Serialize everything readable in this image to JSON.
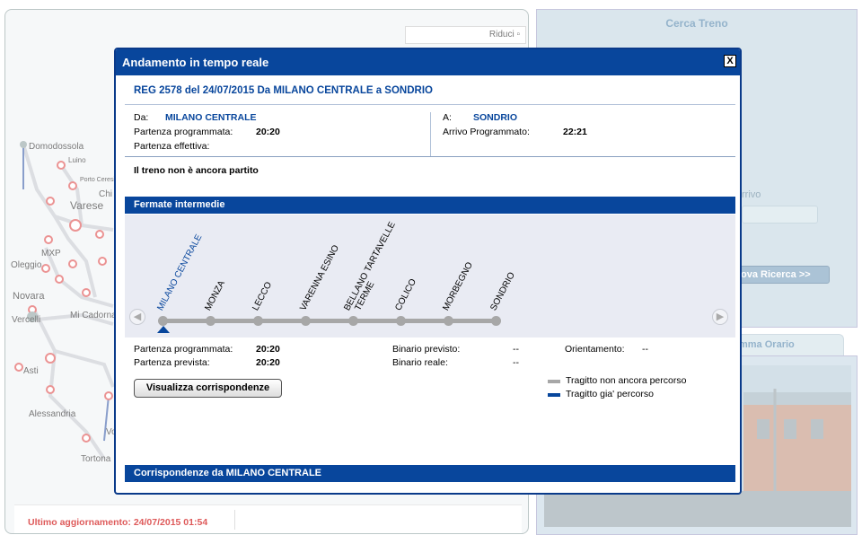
{
  "map": {
    "riduci_label": "Riduci",
    "cities": [
      "Domodossola",
      "Luino",
      "Porto Ceresio",
      "Varese",
      "Chi",
      "MXP",
      "Oleggio",
      "Novara",
      "Vercelli",
      "Mi Cadorna",
      "Asti",
      "Alessandria",
      "Tortona",
      "Vo"
    ]
  },
  "last_update": "Ultimo aggiornamento: 24/07/2015 01:54",
  "right_panel": {
    "title": "Cerca Treno",
    "arrivo_label": "rrivo",
    "nuova_ricerca": "ova Ricerca >>",
    "programma_tab": "mma Orario"
  },
  "modal": {
    "header": "Andamento in tempo reale",
    "close": "X",
    "train_title": "REG 2578 del 24/07/2015 Da MILANO CENTRALE a SONDRIO",
    "da_label": "Da:",
    "da_value": "MILANO CENTRALE",
    "partenza_programmata_label": "Partenza programmata:",
    "partenza_programmata_value": "20:20",
    "partenza_effettiva_label": "Partenza effettiva:",
    "a_label": "A:",
    "a_value": "SONDRIO",
    "arrivo_programmato_label": "Arrivo Programmato:",
    "arrivo_programmato_value": "22:21",
    "status": "Il treno non è ancora partito",
    "fermate_title": "Fermate intermedie",
    "stops": [
      "MILANO CENTRALE",
      "MONZA",
      "LECCO",
      "VARENNA ESINO",
      "BELLANO TARTAVELLE",
      "TERME",
      "COLICO",
      "MORBEGNO",
      "SONDRIO"
    ],
    "nav_left": "◀",
    "nav_right": "▶",
    "details": {
      "partenza_programmata_label": "Partenza programmata:",
      "partenza_programmata_value": "20:20",
      "partenza_prevista_label": "Partenza prevista:",
      "partenza_prevista_value": "20:20",
      "binario_previsto_label": "Binario previsto:",
      "binario_previsto_value": "--",
      "binario_reale_label": "Binario reale:",
      "binario_reale_value": "--",
      "orientamento_label": "Orientamento:",
      "orientamento_value": "--"
    },
    "vis_button": "Visualizza corrispondenze",
    "legend": {
      "non_percorso": "Tragitto non ancora percorso",
      "percorso": "Tragitto gia' percorso",
      "color_non_percorso": "#a7a7a7",
      "color_percorso": "#08469c"
    },
    "corrispondenze_title": "Corrispondenze da MILANO CENTRALE"
  }
}
